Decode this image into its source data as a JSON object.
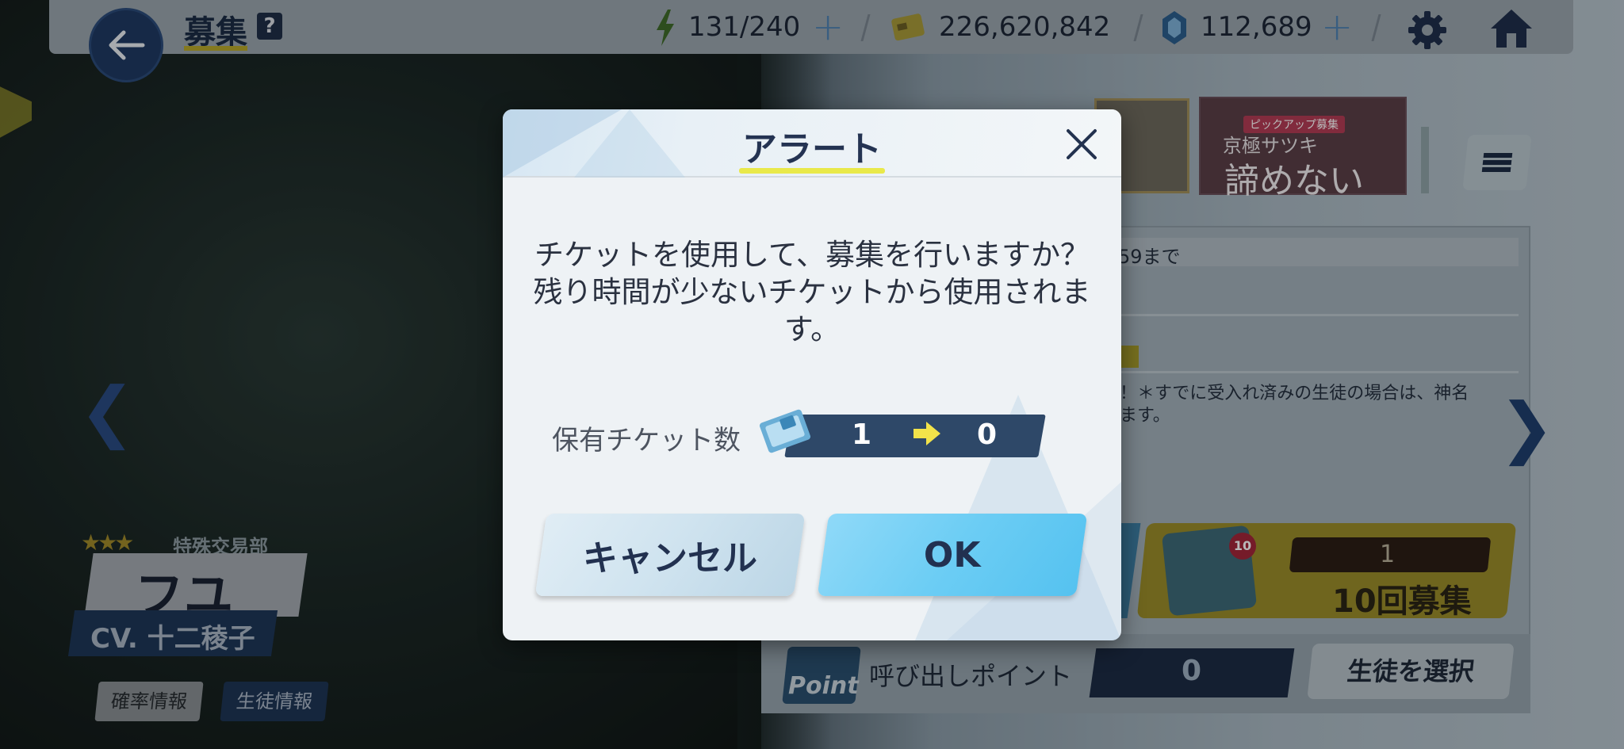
{
  "header": {
    "title": "募集",
    "help_label": "?",
    "ap": "131/240",
    "credits": "226,620,842",
    "pyroxene": "112,689"
  },
  "banners": {
    "pickup_tag": "ピックアップ募集",
    "line1": "京極サツキ",
    "line2": "諦めない"
  },
  "info": {
    "date_fragment": "59まで",
    "note_line1": "！＊すでに受入れ済みの生徒の場合は、神名",
    "note_line2": "ます。"
  },
  "recruit10": {
    "badge": "10",
    "count": "1",
    "label": "10回募集"
  },
  "call_point": {
    "icon_text": "Point",
    "label": "呼び出しポイント",
    "value": "0",
    "select_label": "生徒を選択"
  },
  "character": {
    "stars": "★★★",
    "school": "特殊交易部",
    "name": "フユ",
    "cv": "CV. 十二稜子",
    "rate_info_label": "確率情報",
    "student_info_label": "生徒情報"
  },
  "dialog": {
    "title": "アラート",
    "message_line1": "チケットを使用して、募集を行いますか？",
    "message_line2": "残り時間が少ないチケットから使用されま",
    "message_line3": "す。",
    "ticket_label": "保有チケット数",
    "ticket_from": "1",
    "ticket_to": "0",
    "cancel_label": "キャンセル",
    "ok_label": "OK"
  },
  "colors": {
    "accent_blue": "#55c2f0",
    "header_navy": "#243352",
    "title_underline": "#e9e94a",
    "ticket_bar": "#2e4868"
  }
}
